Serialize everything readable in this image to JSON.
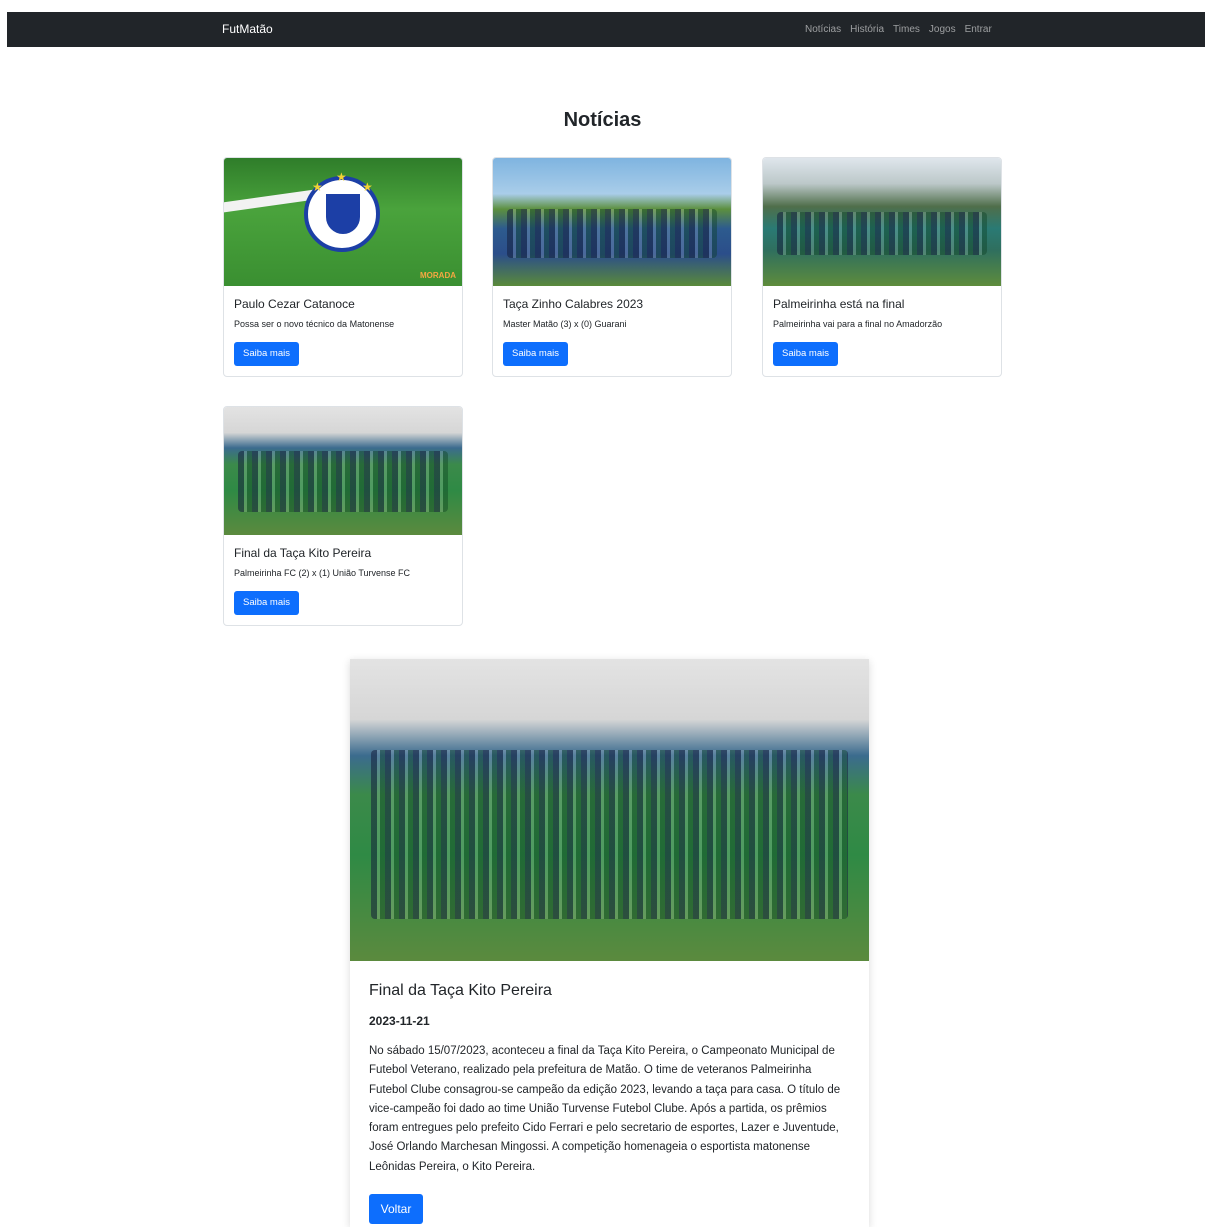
{
  "navbar": {
    "brand": "FutMatão",
    "links": [
      "Notícias",
      "História",
      "Times",
      "Jogos",
      "Entrar"
    ]
  },
  "page": {
    "title": "Notícias"
  },
  "cards": [
    {
      "title": "Paulo Cezar Catanoce",
      "text": "Possa ser o novo técnico da Matonense",
      "button": "Saiba mais",
      "image_icon": "team-crest-image",
      "image_label": "MORADA"
    },
    {
      "title": "Taça Zinho Calabres 2023",
      "text": "Master Matão (3) x (0) Guarani",
      "button": "Saiba mais",
      "image_icon": "team-photo-image"
    },
    {
      "title": "Palmeirinha está na final",
      "text": "Palmeirinha vai para a final no Amadorzão",
      "button": "Saiba mais",
      "image_icon": "team-photo-image"
    },
    {
      "title": "Final da Taça Kito Pereira",
      "text": "Palmeirinha FC (2) x (1) União Turvense FC",
      "button": "Saiba mais",
      "image_icon": "celebration-photo-image"
    }
  ],
  "detail": {
    "title": "Final da Taça Kito Pereira",
    "date": "2023-11-21",
    "body": "No sábado 15/07/2023, aconteceu a final da Taça Kito Pereira, o Campeonato Municipal de Futebol Veterano, realizado pela prefeitura de Matão. O time de veteranos Palmeirinha Futebol Clube consagrou-se campeão da edição 2023, levando a taça para casa. O título de vice-campeão foi dado ao time União Turvense Futebol Clube. Após a partida, os prêmios foram entregues pelo prefeito Cido Ferrari e pelo secretario de esportes, Lazer e Juventude, José Orlando Marchesan Mingossi. A competição homenageia o esportista matonense Leônidas Pereira, o Kito Pereira.",
    "button": "Voltar"
  },
  "colors": {
    "navbar": "#212529",
    "primary": "#0d6efd"
  }
}
